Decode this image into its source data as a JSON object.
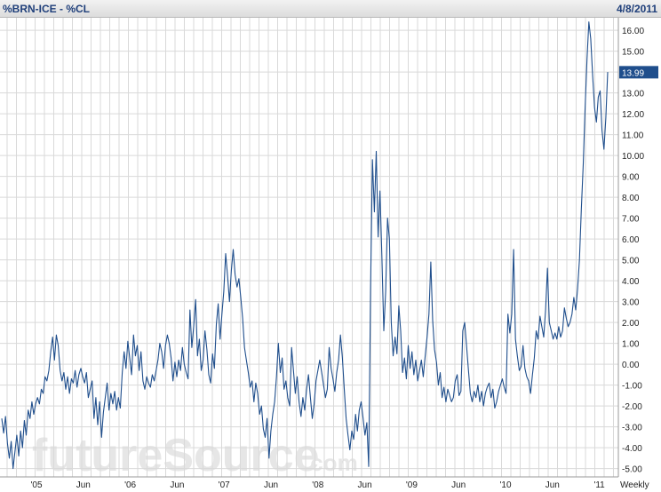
{
  "header": {
    "title": "%BRN-ICE - %CL",
    "date": "4/8/2011"
  },
  "watermark": {
    "main": "futureSource",
    "suffix": ".com"
  },
  "colors": {
    "line": "#1f4e8c",
    "grid": "#d9d9d9",
    "badge_bg": "#1f4e8c",
    "badge_text": "#ffffff",
    "header_text": "#1f3f7a"
  },
  "chart_data": {
    "type": "line",
    "title": "%BRN-ICE - %CL",
    "period_label": "Weekly",
    "ylim": [
      -5.4,
      16.6
    ],
    "y_ticks": [
      -5,
      -4,
      -3,
      -2,
      -1,
      0,
      1,
      2,
      3,
      4,
      5,
      6,
      7,
      8,
      9,
      10,
      11,
      12,
      13,
      14,
      15,
      16
    ],
    "x_labels": [
      "'05",
      "Jun",
      "'06",
      "Jun",
      "'07",
      "Jun",
      "'08",
      "Jun",
      "'09",
      "Jun",
      "'10",
      "Jun",
      "'11"
    ],
    "last_value": "13.99",
    "grid": true,
    "series": [
      {
        "x_start": "2004-11",
        "frequency": "weekly",
        "values": [
          -2.6,
          -3.3,
          -2.5,
          -3.8,
          -4.5,
          -3.7,
          -5.0,
          -4.2,
          -3.4,
          -4.4,
          -3.2,
          -4.0,
          -2.7,
          -3.4,
          -2.2,
          -2.6,
          -1.8,
          -2.4,
          -1.9,
          -1.6,
          -1.9,
          -1.2,
          -1.4,
          -0.6,
          -0.8,
          -0.3,
          0.6,
          1.3,
          0.2,
          1.4,
          0.9,
          -0.3,
          -0.8,
          -0.4,
          -1.2,
          -0.6,
          -1.4,
          -0.7,
          -0.9,
          -0.3,
          -1.1,
          -0.5,
          -0.2,
          -0.6,
          -0.9,
          -0.4,
          -1.6,
          -1.2,
          -0.8,
          -2.6,
          -1.6,
          -2.9,
          -1.8,
          -3.5,
          -2.3,
          -1.6,
          -0.9,
          -2.2,
          -1.4,
          -1.9,
          -1.3,
          -2.2,
          -1.6,
          -2.1,
          -0.4,
          0.6,
          -0.2,
          1.1,
          0.3,
          -0.5,
          1.4,
          0.4,
          0.9,
          -0.3,
          0.6,
          -0.8,
          -1.2,
          -0.6,
          -0.9,
          -1.1,
          -0.5,
          -0.8,
          -0.3,
          0.2,
          1.0,
          0.6,
          -0.2,
          0.9,
          1.4,
          1.0,
          0.3,
          -0.8,
          0.1,
          -0.6,
          0.2,
          -0.3,
          0.8,
          0.0,
          -0.4,
          -0.7,
          2.6,
          0.8,
          1.8,
          3.1,
          0.4,
          1.2,
          -0.3,
          0.2,
          1.6,
          0.7,
          -0.5,
          -0.9,
          0.5,
          -0.2,
          1.9,
          2.9,
          1.2,
          2.4,
          3.5,
          5.3,
          4.2,
          3.0,
          4.5,
          5.5,
          4.3,
          3.7,
          4.1,
          3.2,
          2.2,
          0.8,
          0.2,
          -0.4,
          -1.1,
          -0.8,
          -1.8,
          -0.9,
          -1.4,
          -2.4,
          -2.0,
          -3.1,
          -3.5,
          -2.6,
          -4.5,
          -3.2,
          -2.4,
          -1.8,
          -0.6,
          1.0,
          -0.4,
          0.3,
          -1.2,
          -0.8,
          -1.6,
          -2.0,
          0.8,
          -0.3,
          -1.4,
          -0.6,
          -1.8,
          -2.5,
          -1.6,
          -2.2,
          -1.2,
          -0.5,
          -1.6,
          -2.6,
          -1.9,
          -0.8,
          -0.3,
          0.2,
          -0.4,
          -1.0,
          -1.6,
          -1.2,
          0.8,
          -0.2,
          -0.7,
          -1.3,
          -0.4,
          0.2,
          1.4,
          0.3,
          -1.2,
          -2.6,
          -3.4,
          -4.1,
          -3.2,
          -3.6,
          -2.4,
          -3.2,
          -2.2,
          -1.8,
          -2.6,
          -3.4,
          -2.8,
          -4.9,
          3.6,
          9.8,
          7.3,
          10.2,
          6.1,
          8.3,
          5.2,
          1.6,
          3.5,
          7.0,
          6.0,
          2.0,
          0.4,
          1.3,
          0.5,
          2.8,
          1.6,
          -0.4,
          0.3,
          -0.7,
          0.9,
          -0.2,
          0.6,
          -0.5,
          0.2,
          -0.8,
          -0.3,
          0.2,
          -0.6,
          0.4,
          1.3,
          2.4,
          4.9,
          2.1,
          0.7,
          0.1,
          -1.0,
          -0.4,
          -1.6,
          -1.1,
          -1.8,
          -1.2,
          -1.5,
          -1.8,
          -1.6,
          -0.8,
          -0.5,
          -1.5,
          -1.3,
          1.6,
          2.0,
          0.9,
          -0.3,
          -1.4,
          -1.8,
          -1.3,
          -1.6,
          -1.0,
          -1.8,
          -1.3,
          -2.0,
          -1.4,
          -1.1,
          -0.9,
          -1.6,
          -1.2,
          -2.1,
          -1.8,
          -1.3,
          -1.0,
          -0.7,
          -1.1,
          -1.4,
          2.4,
          1.5,
          2.4,
          5.5,
          1.2,
          0.4,
          -0.3,
          -0.1,
          0.9,
          -0.2,
          -0.6,
          -0.8,
          -1.4,
          -0.5,
          0.3,
          1.6,
          1.2,
          2.3,
          1.8,
          1.3,
          2.6,
          4.6,
          2.0,
          1.6,
          1.2,
          1.5,
          1.2,
          1.8,
          1.3,
          1.6,
          2.7,
          2.2,
          1.8,
          2.0,
          2.4,
          3.2,
          2.6,
          3.6,
          5.0,
          7.4,
          9.6,
          12.3,
          14.6,
          16.4,
          15.6,
          13.8,
          12.3,
          11.6,
          12.8,
          13.1,
          11.2,
          10.3,
          11.8,
          14.0
        ]
      }
    ]
  }
}
